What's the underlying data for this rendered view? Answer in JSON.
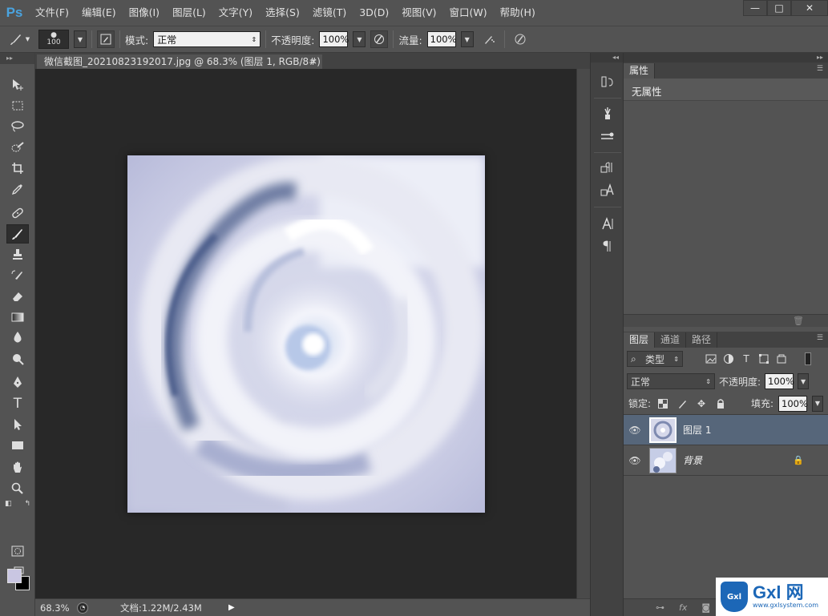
{
  "app": {
    "logo": "Ps"
  },
  "menu": [
    "文件(F)",
    "编辑(E)",
    "图像(I)",
    "图层(L)",
    "文字(Y)",
    "选择(S)",
    "滤镜(T)",
    "3D(D)",
    "视图(V)",
    "窗口(W)",
    "帮助(H)"
  ],
  "window_controls": {
    "minimize": "—",
    "restore": "□",
    "close": "✕"
  },
  "options": {
    "brush_size": "100",
    "mode_label": "模式:",
    "mode_value": "正常",
    "opacity_label": "不透明度:",
    "opacity_value": "100%",
    "flow_label": "流量:",
    "flow_value": "100%"
  },
  "document": {
    "tab_title": "微信截图_20210823192017.jpg @ 68.3% (图层 1, RGB/8#) *",
    "tab_close": "×"
  },
  "status": {
    "zoom": "68.3%",
    "doc_info": "文档:1.22M/2.43M"
  },
  "properties": {
    "tab_label": "属性",
    "content": "无属性"
  },
  "layers_panel": {
    "tabs": [
      "图层",
      "通道",
      "路径"
    ],
    "filter_type": "类型",
    "blend_mode": "正常",
    "opacity_label": "不透明度:",
    "opacity_value": "100%",
    "lock_label": "锁定:",
    "fill_label": "填充:",
    "fill_value": "100%",
    "layers": [
      {
        "name": "图层 1",
        "selected": true
      },
      {
        "name": "背景",
        "locked": true
      }
    ]
  },
  "watermark": {
    "badge": "Gxl",
    "main": "Gxl 网",
    "sub": "www.gxlsystem.com"
  },
  "colors": {
    "foreground": "#c9c6e2",
    "background": "#000000",
    "selection": "#56667a",
    "canvas_bg": "#282828"
  }
}
